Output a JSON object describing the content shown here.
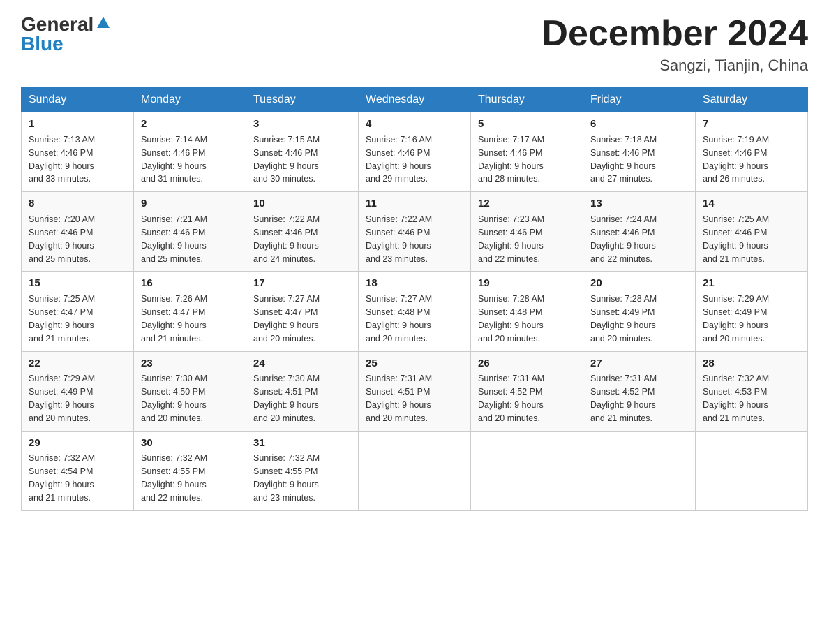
{
  "header": {
    "logo_general": "General",
    "logo_blue": "Blue",
    "month_title": "December 2024",
    "location": "Sangzi, Tianjin, China"
  },
  "weekdays": [
    "Sunday",
    "Monday",
    "Tuesday",
    "Wednesday",
    "Thursday",
    "Friday",
    "Saturday"
  ],
  "weeks": [
    [
      {
        "day": "1",
        "sunrise": "7:13 AM",
        "sunset": "4:46 PM",
        "daylight": "9 hours and 33 minutes."
      },
      {
        "day": "2",
        "sunrise": "7:14 AM",
        "sunset": "4:46 PM",
        "daylight": "9 hours and 31 minutes."
      },
      {
        "day": "3",
        "sunrise": "7:15 AM",
        "sunset": "4:46 PM",
        "daylight": "9 hours and 30 minutes."
      },
      {
        "day": "4",
        "sunrise": "7:16 AM",
        "sunset": "4:46 PM",
        "daylight": "9 hours and 29 minutes."
      },
      {
        "day": "5",
        "sunrise": "7:17 AM",
        "sunset": "4:46 PM",
        "daylight": "9 hours and 28 minutes."
      },
      {
        "day": "6",
        "sunrise": "7:18 AM",
        "sunset": "4:46 PM",
        "daylight": "9 hours and 27 minutes."
      },
      {
        "day": "7",
        "sunrise": "7:19 AM",
        "sunset": "4:46 PM",
        "daylight": "9 hours and 26 minutes."
      }
    ],
    [
      {
        "day": "8",
        "sunrise": "7:20 AM",
        "sunset": "4:46 PM",
        "daylight": "9 hours and 25 minutes."
      },
      {
        "day": "9",
        "sunrise": "7:21 AM",
        "sunset": "4:46 PM",
        "daylight": "9 hours and 25 minutes."
      },
      {
        "day": "10",
        "sunrise": "7:22 AM",
        "sunset": "4:46 PM",
        "daylight": "9 hours and 24 minutes."
      },
      {
        "day": "11",
        "sunrise": "7:22 AM",
        "sunset": "4:46 PM",
        "daylight": "9 hours and 23 minutes."
      },
      {
        "day": "12",
        "sunrise": "7:23 AM",
        "sunset": "4:46 PM",
        "daylight": "9 hours and 22 minutes."
      },
      {
        "day": "13",
        "sunrise": "7:24 AM",
        "sunset": "4:46 PM",
        "daylight": "9 hours and 22 minutes."
      },
      {
        "day": "14",
        "sunrise": "7:25 AM",
        "sunset": "4:46 PM",
        "daylight": "9 hours and 21 minutes."
      }
    ],
    [
      {
        "day": "15",
        "sunrise": "7:25 AM",
        "sunset": "4:47 PM",
        "daylight": "9 hours and 21 minutes."
      },
      {
        "day": "16",
        "sunrise": "7:26 AM",
        "sunset": "4:47 PM",
        "daylight": "9 hours and 21 minutes."
      },
      {
        "day": "17",
        "sunrise": "7:27 AM",
        "sunset": "4:47 PM",
        "daylight": "9 hours and 20 minutes."
      },
      {
        "day": "18",
        "sunrise": "7:27 AM",
        "sunset": "4:48 PM",
        "daylight": "9 hours and 20 minutes."
      },
      {
        "day": "19",
        "sunrise": "7:28 AM",
        "sunset": "4:48 PM",
        "daylight": "9 hours and 20 minutes."
      },
      {
        "day": "20",
        "sunrise": "7:28 AM",
        "sunset": "4:49 PM",
        "daylight": "9 hours and 20 minutes."
      },
      {
        "day": "21",
        "sunrise": "7:29 AM",
        "sunset": "4:49 PM",
        "daylight": "9 hours and 20 minutes."
      }
    ],
    [
      {
        "day": "22",
        "sunrise": "7:29 AM",
        "sunset": "4:49 PM",
        "daylight": "9 hours and 20 minutes."
      },
      {
        "day": "23",
        "sunrise": "7:30 AM",
        "sunset": "4:50 PM",
        "daylight": "9 hours and 20 minutes."
      },
      {
        "day": "24",
        "sunrise": "7:30 AM",
        "sunset": "4:51 PM",
        "daylight": "9 hours and 20 minutes."
      },
      {
        "day": "25",
        "sunrise": "7:31 AM",
        "sunset": "4:51 PM",
        "daylight": "9 hours and 20 minutes."
      },
      {
        "day": "26",
        "sunrise": "7:31 AM",
        "sunset": "4:52 PM",
        "daylight": "9 hours and 20 minutes."
      },
      {
        "day": "27",
        "sunrise": "7:31 AM",
        "sunset": "4:52 PM",
        "daylight": "9 hours and 21 minutes."
      },
      {
        "day": "28",
        "sunrise": "7:32 AM",
        "sunset": "4:53 PM",
        "daylight": "9 hours and 21 minutes."
      }
    ],
    [
      {
        "day": "29",
        "sunrise": "7:32 AM",
        "sunset": "4:54 PM",
        "daylight": "9 hours and 21 minutes."
      },
      {
        "day": "30",
        "sunrise": "7:32 AM",
        "sunset": "4:55 PM",
        "daylight": "9 hours and 22 minutes."
      },
      {
        "day": "31",
        "sunrise": "7:32 AM",
        "sunset": "4:55 PM",
        "daylight": "9 hours and 23 minutes."
      },
      null,
      null,
      null,
      null
    ]
  ],
  "labels": {
    "sunrise": "Sunrise:",
    "sunset": "Sunset:",
    "daylight": "Daylight:"
  }
}
